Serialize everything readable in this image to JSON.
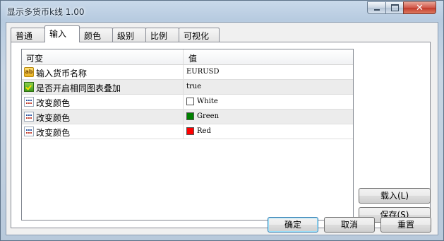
{
  "window": {
    "title": "显示多货币k线 1.00",
    "close_glyph": "✕"
  },
  "tabs": [
    "普通",
    "输入",
    "颜色",
    "级别",
    "比例",
    "可视化"
  ],
  "grid": {
    "headers": {
      "variable": "可变",
      "value": "值"
    },
    "rows": [
      {
        "icon": "ab-icon",
        "name": "输入货币名称",
        "value": "EURUSD"
      },
      {
        "icon": "bool-icon",
        "name": "是否开启相同图表叠加",
        "value": "true"
      },
      {
        "icon": "color-icon",
        "name": "改变颜色",
        "value": "White",
        "color": "#ffffff"
      },
      {
        "icon": "color-icon",
        "name": "改变颜色",
        "value": "Green",
        "color": "#008000"
      },
      {
        "icon": "color-icon",
        "name": "改变颜色",
        "value": "Red",
        "color": "#ff0000"
      }
    ]
  },
  "side_buttons": {
    "load": "载入(L)",
    "save": "保存(S)"
  },
  "footer_buttons": {
    "ok": "确定",
    "cancel": "取消",
    "reset": "重置"
  }
}
